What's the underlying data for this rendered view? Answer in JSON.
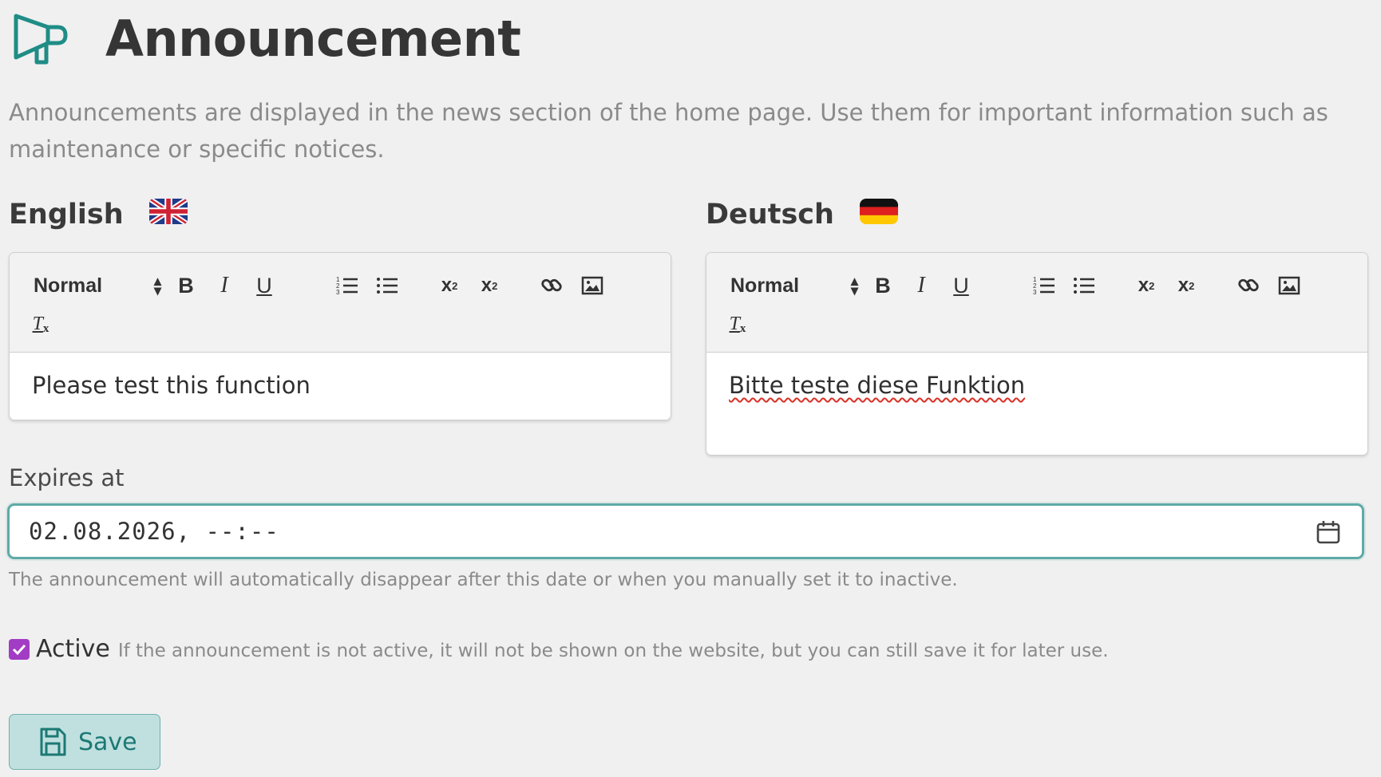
{
  "page": {
    "title": "Announcement",
    "title_icon": "megaphone-icon",
    "description": "Announcements are displayed in the news section of the home page. Use them for important information such as maintenance or specific notices."
  },
  "languages": [
    {
      "label": "English",
      "flag": "uk-flag-icon",
      "toolbar": {
        "format_select": "Normal"
      },
      "content": "Please test this function"
    },
    {
      "label": "Deutsch",
      "flag": "germany-flag-icon",
      "toolbar": {
        "format_select": "Normal"
      },
      "content": "Bitte teste diese Funktion"
    }
  ],
  "expires": {
    "label": "Expires at",
    "value": "02.08.2026, --:--",
    "help": "The announcement will automatically disappear after this date or when you manually set it to inactive."
  },
  "active": {
    "checked": true,
    "label": "Active",
    "help": "If the announcement is not active, it will not be shown on the website, but you can still save it for later use."
  },
  "save_button": {
    "label": "Save"
  },
  "colors": {
    "accent": "#1c7974",
    "focus_border": "#5eaaa6",
    "checkbox": "#a23cc4",
    "save_bg": "#c0e0df"
  }
}
